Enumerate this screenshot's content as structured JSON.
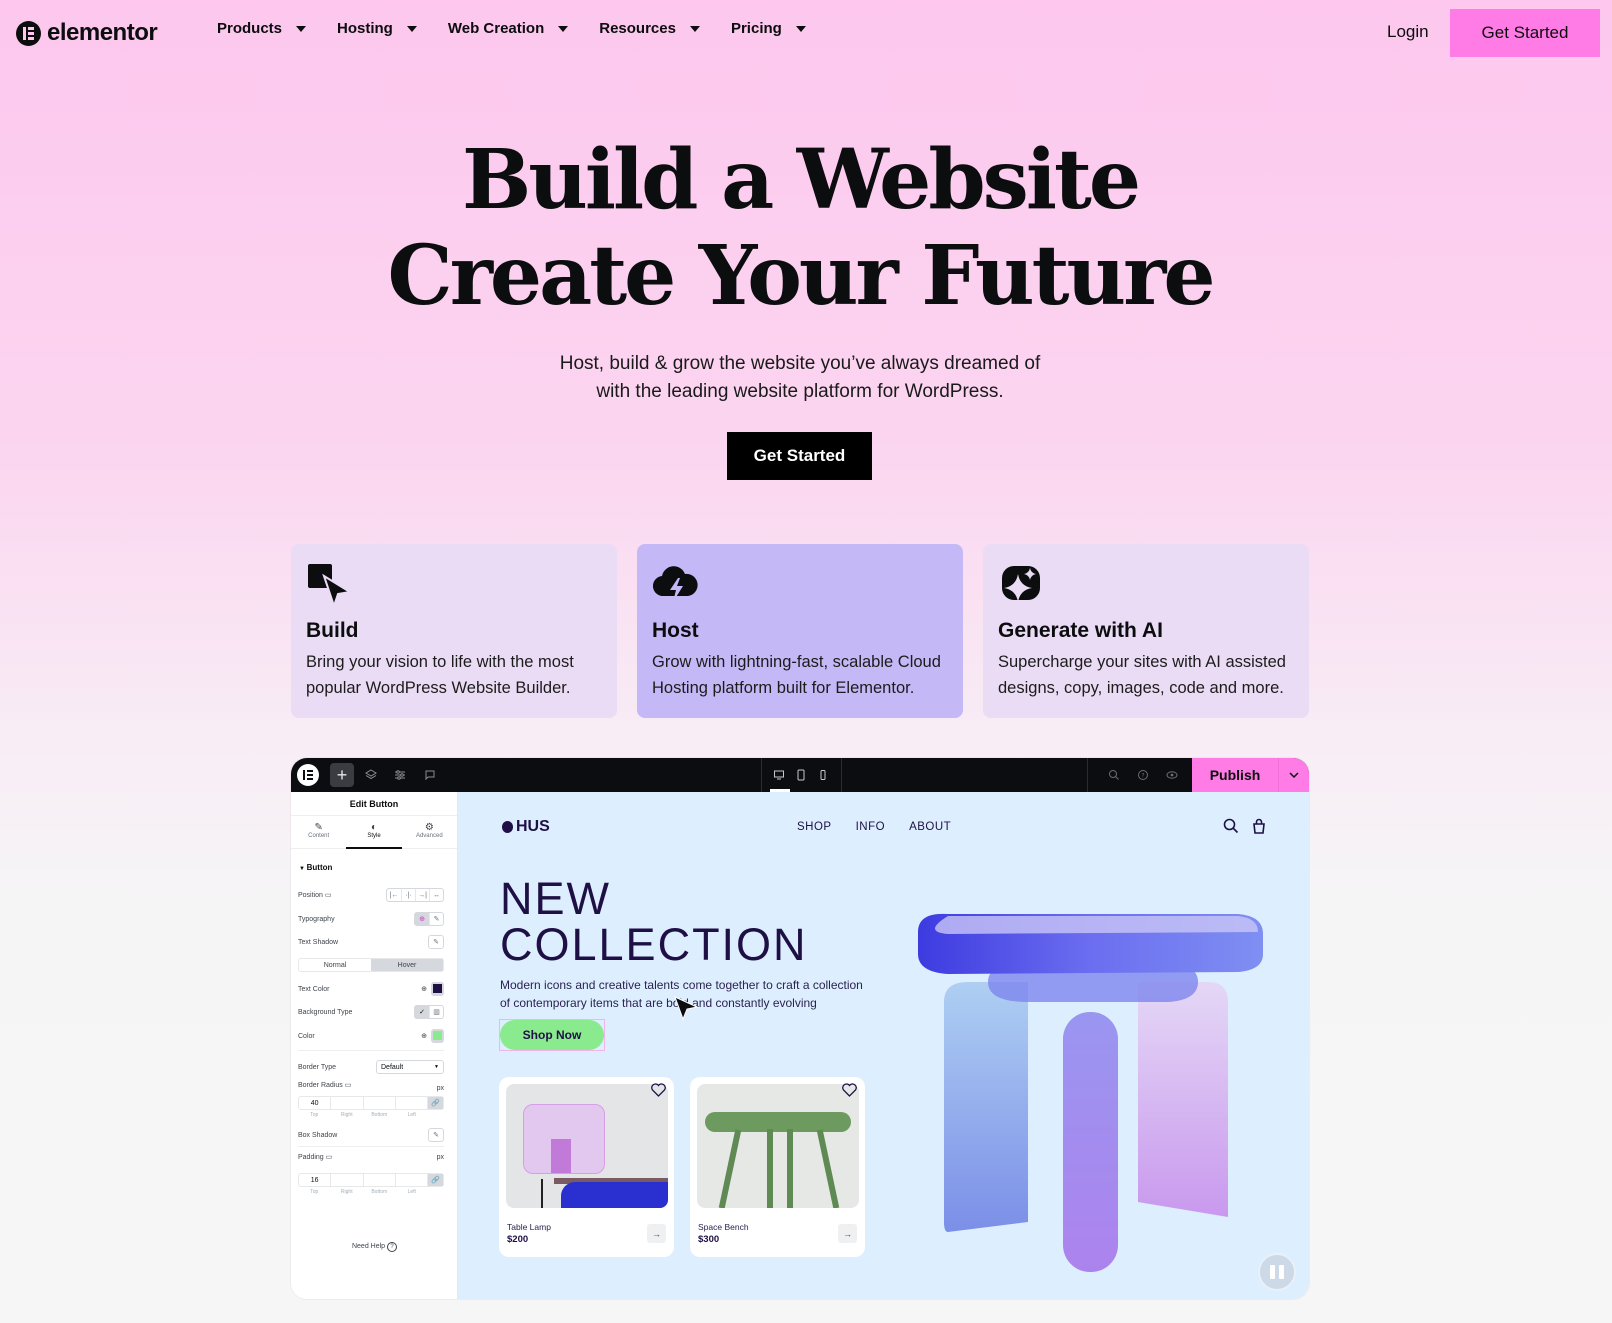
{
  "nav": {
    "brand": "elementor",
    "menu": [
      {
        "label": "Products"
      },
      {
        "label": "Hosting"
      },
      {
        "label": "Web Creation"
      },
      {
        "label": "Resources"
      },
      {
        "label": "Pricing"
      }
    ],
    "login": "Login",
    "cta": "Get Started",
    "accent": "#ff7be5"
  },
  "hero": {
    "title_line1": "Build a Website",
    "title_line2": "Create Your Future",
    "subtitle_line1": "Host, build & grow the website you’ve always dreamed of",
    "subtitle_line2": "with the leading website platform for WordPress.",
    "cta": "Get Started"
  },
  "features": [
    {
      "icon": "build-cursor-icon",
      "title": "Build",
      "desc": "Bring your vision to life with the most popular WordPress Website Builder.",
      "active": false
    },
    {
      "icon": "cloud-bolt-icon",
      "title": "Host",
      "desc": "Grow with lightning-fast, scalable Cloud Hosting platform built for Elementor.",
      "active": true
    },
    {
      "icon": "ai-sparkle-icon",
      "title": "Generate with AI",
      "desc": "Supercharge your sites with AI assisted designs, copy, images, code and more.",
      "active": false
    }
  ],
  "editor": {
    "topbar": {
      "publish": "Publish",
      "left_icons": [
        "elementor-logo-icon",
        "plus-icon",
        "layers-icon",
        "settings-sliders-icon",
        "comment-icon"
      ],
      "device_icons": [
        "desktop-icon",
        "tablet-icon",
        "mobile-icon"
      ],
      "right_icons": [
        "search-icon",
        "help-icon",
        "preview-eye-icon"
      ]
    },
    "panel": {
      "title": "Edit Button",
      "tabs": [
        {
          "label": "Content",
          "icon": "pencil-icon"
        },
        {
          "label": "Style",
          "icon": "contrast-icon",
          "active": true
        },
        {
          "label": "Advanced",
          "icon": "gear-icon"
        }
      ],
      "section": "Button",
      "position_label": "Position",
      "typography_label": "Typography",
      "text_shadow_label": "Text Shadow",
      "state_tabs": [
        "Normal",
        "Hover"
      ],
      "active_state": "Hover",
      "text_color_label": "Text Color",
      "text_color": "#1e0f45",
      "bg_type_label": "Background Type",
      "color_label": "Color",
      "color": "#8aea8e",
      "border_type_label": "Border Type",
      "border_type_value": "Default",
      "border_radius_label": "Border Radius",
      "border_radius_unit": "px",
      "border_radius_top": "40",
      "dim_labels": [
        "Top",
        "Right",
        "Bottom",
        "Left"
      ],
      "box_shadow_label": "Box Shadow",
      "padding_label": "Padding",
      "padding_unit": "px",
      "padding_top": "16",
      "help": "Need Help"
    },
    "site": {
      "brand": "HUS",
      "menu": [
        "SHOP",
        "INFO",
        "ABOUT"
      ],
      "headline_line1": "NEW",
      "headline_line2": "COLLECTION",
      "desc_line1": "Modern icons and creative talents come together to craft a collection",
      "desc_line2": "of contemporary items that are bold and constantly evolving",
      "shop_cta": "Shop Now",
      "products": [
        {
          "name": "Table Lamp",
          "price": "$200"
        },
        {
          "name": "Space Bench",
          "price": "$300"
        }
      ]
    }
  }
}
